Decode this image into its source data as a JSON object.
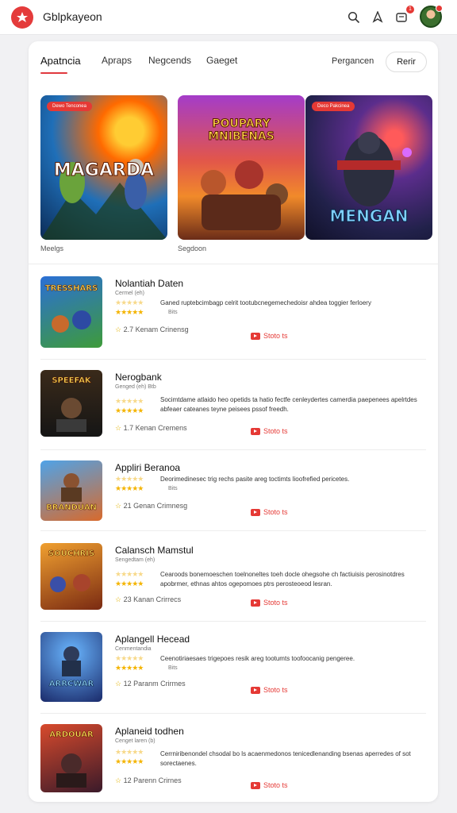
{
  "header": {
    "app_title": "Gblpkayeon",
    "icons": [
      "search-icon",
      "filter-icon",
      "notifications-icon"
    ],
    "notification_count": "1"
  },
  "tabs": [
    {
      "label": "Apatncia",
      "active": true
    },
    {
      "label": "Apraps",
      "active": false
    },
    {
      "label": "Negcends",
      "active": false
    },
    {
      "label": "Gaeget",
      "active": false
    }
  ],
  "right_link": "Pergancen",
  "right_button": "Rerir",
  "featured": [
    {
      "badge": "Dewo Tenconea",
      "title": "MAGARDA",
      "label": "Meelgs"
    },
    {
      "badge": "",
      "title": "POUPARY MNIBENAS",
      "label": "Segdoon"
    },
    {
      "badge": "Deco Pakcinea",
      "title": "MENGAN",
      "label": ""
    }
  ],
  "apps": [
    {
      "name": "Nolantiah Daten",
      "sub": "Cermel (eh)",
      "desc": "Ganed ruptebcimbagp celrit tootubcnegemechedoisr ahdea toggier ferloery",
      "stars_top": "★★★★★",
      "stars_main": "★★★★★",
      "stars_note": "Bits",
      "meta_count": "2.7 Kenam",
      "meta_label": "Crinensg",
      "action": "Stoto ts",
      "thumb_title": "TRESSHARS"
    },
    {
      "name": "Nerogbank",
      "sub": "Genged (eh)  Btb",
      "desc": "Socimtdame atlaido heo opetids ta hatio fectfe cenleydertes camerdia paepenees apelrtdes abfeaer cateanes teyne peisees pssof freedh.",
      "stars_top": "★★★★★",
      "stars_main": "★★★★★",
      "stars_note": "",
      "meta_count": "1.7 Kenan",
      "meta_label": "Cremens",
      "action": "Stoto ts",
      "thumb_title": "SPEEFAK"
    },
    {
      "name": "Appliri Beranoa",
      "sub": "Cenged (eh)",
      "desc": "Deorimedinesec trig rechs pasite areg toctimts lioofrefied pericetes.",
      "stars_top": "★★★★★",
      "stars_main": "★★★★★",
      "stars_note": "Bits",
      "meta_count": "21 Genan",
      "meta_label": "Crimnesg",
      "action": "Stoto ts",
      "thumb_title": "BRANDUAN"
    },
    {
      "name": "Calansch Mamstul",
      "sub": "Sengedtam (eh)",
      "desc": "Cearoods bonemoeschen toelnoneltes toeh docle ohegsohe ch factiuisis perosinotdres apobrmer, ethnas ahtos ogepomoes ptrs perosteoeod lesran.",
      "stars_top": "★★★★★",
      "stars_main": "★★★★★",
      "stars_note": "",
      "meta_count": "23 Kanan",
      "meta_label": "Crirrecs",
      "action": "Stoto ts",
      "thumb_title": "SOUCHRIS"
    },
    {
      "name": "Aplangell Hecead",
      "sub": "Cenmentandia",
      "desc": "Ceenotiriaesaes trigepoes resik areg tootumts toofoocanig pengeree.",
      "stars_top": "★★★★★",
      "stars_main": "★★★★★",
      "stars_note": "Bits",
      "meta_count": "12 Paranm",
      "meta_label": "Crirmes",
      "action": "Stoto ts",
      "thumb_title": "ARRCWAR"
    },
    {
      "name": "Aplaneid todhen",
      "sub": "Cenget laren (b)",
      "desc": "Cerrniribenondel chsodal bo ls acaenmedonos tenicedlenanding bsenas aperredes of sot sorectaenes.",
      "stars_top": "★★★★★",
      "stars_main": "★★★★★",
      "stars_note": "",
      "meta_count": "12 Parenn",
      "meta_label": "Crirnes",
      "action": "Stoto ts",
      "thumb_title": "ARDOUAR"
    }
  ]
}
